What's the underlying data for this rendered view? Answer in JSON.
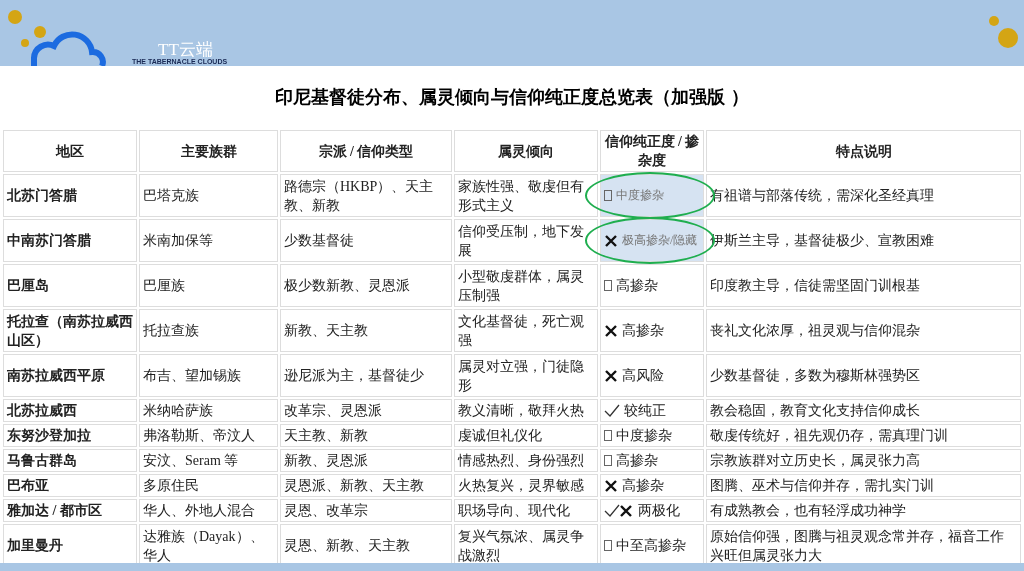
{
  "header": {
    "brand": "TT云端",
    "tagline": "THE TABERNACLE CLOUDS"
  },
  "title": "印尼基督徒分布、属灵倾向与信仰纯正度总览表（加强版 ）",
  "table": {
    "columns": [
      "地区",
      "主要族群",
      "宗派 / 信仰类型",
      "属灵倾向",
      "信仰纯正度 / 掺杂度",
      "特点说明"
    ],
    "rows": [
      {
        "region": "北苏门答腊",
        "ethnic": "巴塔克族",
        "denomination": "路德宗（HKBP）、天主教、新教",
        "tendency": "家族性强、敬虔但有形式主义",
        "purity": {
          "kind": "box",
          "label": "中度掺杂"
        },
        "highlighted": true,
        "notes": "有祖谱与部落传统，需深化圣经真理"
      },
      {
        "region": "中南苏门答腊",
        "ethnic": "米南加保等",
        "denomination": "少数基督徒",
        "tendency": "信仰受压制，地下发展",
        "purity": {
          "kind": "cross",
          "label": "极高掺杂/隐藏"
        },
        "highlighted": true,
        "notes": "伊斯兰主导，基督徒极少、宣教困难"
      },
      {
        "region": "巴厘岛",
        "ethnic": "巴厘族",
        "denomination": "极少数新教、灵恩派",
        "tendency": "小型敬虔群体，属灵压制强",
        "purity": {
          "kind": "box",
          "label": "高掺杂"
        },
        "highlighted": false,
        "notes": "印度教主导，信徒需坚固门训根基"
      },
      {
        "region": "托拉查（南苏拉威西山区）",
        "ethnic": "托拉查族",
        "denomination": "新教、天主教",
        "tendency": "文化基督徒，死亡观强",
        "purity": {
          "kind": "cross",
          "label": "高掺杂"
        },
        "highlighted": false,
        "notes": "丧礼文化浓厚，祖灵观与信仰混杂"
      },
      {
        "region": "南苏拉威西平原",
        "ethnic": "布吉、望加锡族",
        "denomination": "逊尼派为主，基督徒少",
        "tendency": "属灵对立强，门徒隐形",
        "purity": {
          "kind": "cross",
          "label": "高风险"
        },
        "highlighted": false,
        "notes": "少数基督徒，多数为穆斯林强势区"
      },
      {
        "region": "北苏拉威西",
        "ethnic": "米纳哈萨族",
        "denomination": "改革宗、灵恩派",
        "tendency": "教义清晰，敬拜火热",
        "purity": {
          "kind": "check",
          "label": "较纯正"
        },
        "highlighted": false,
        "notes": "教会稳固，教育文化支持信仰成长"
      },
      {
        "region": "东努沙登加拉",
        "ethnic": "弗洛勒斯、帝汶人",
        "denomination": "天主教、新教",
        "tendency": "虔诚但礼仪化",
        "purity": {
          "kind": "box",
          "label": "中度掺杂"
        },
        "highlighted": false,
        "notes": "敬虔传统好，祖先观仍存，需真理门训"
      },
      {
        "region": "马鲁古群岛",
        "ethnic": "安汶、Seram 等",
        "denomination": "新教、灵恩派",
        "tendency": "情感热烈、身份强烈",
        "purity": {
          "kind": "box",
          "label": "高掺杂"
        },
        "highlighted": false,
        "notes": "宗教族群对立历史长，属灵张力高"
      },
      {
        "region": "巴布亚",
        "ethnic": "多原住民",
        "denomination": "灵恩派、新教、天主教",
        "tendency": "火热复兴，灵界敏感",
        "purity": {
          "kind": "cross",
          "label": "高掺杂"
        },
        "highlighted": false,
        "notes": "图腾、巫术与信仰并存，需扎实门训"
      },
      {
        "region": "雅加达 / 都市区",
        "ethnic": "华人、外地人混合",
        "denomination": "灵恩、改革宗",
        "tendency": "职场导向、现代化",
        "purity": {
          "kind": "check-cross",
          "label": "两极化"
        },
        "highlighted": false,
        "notes": "有成熟教会，也有轻浮成功神学"
      },
      {
        "region": "加里曼丹",
        "ethnic": "达雅族（Dayak）、华人",
        "denomination": "灵恩、新教、天主教",
        "tendency": "复兴气氛浓、属灵争战激烈",
        "purity": {
          "kind": "box",
          "label": "中至高掺杂"
        },
        "highlighted": false,
        "notes": "原始信仰强，图腾与祖灵观念常并存，福音工作兴旺但属灵张力大"
      }
    ]
  }
}
